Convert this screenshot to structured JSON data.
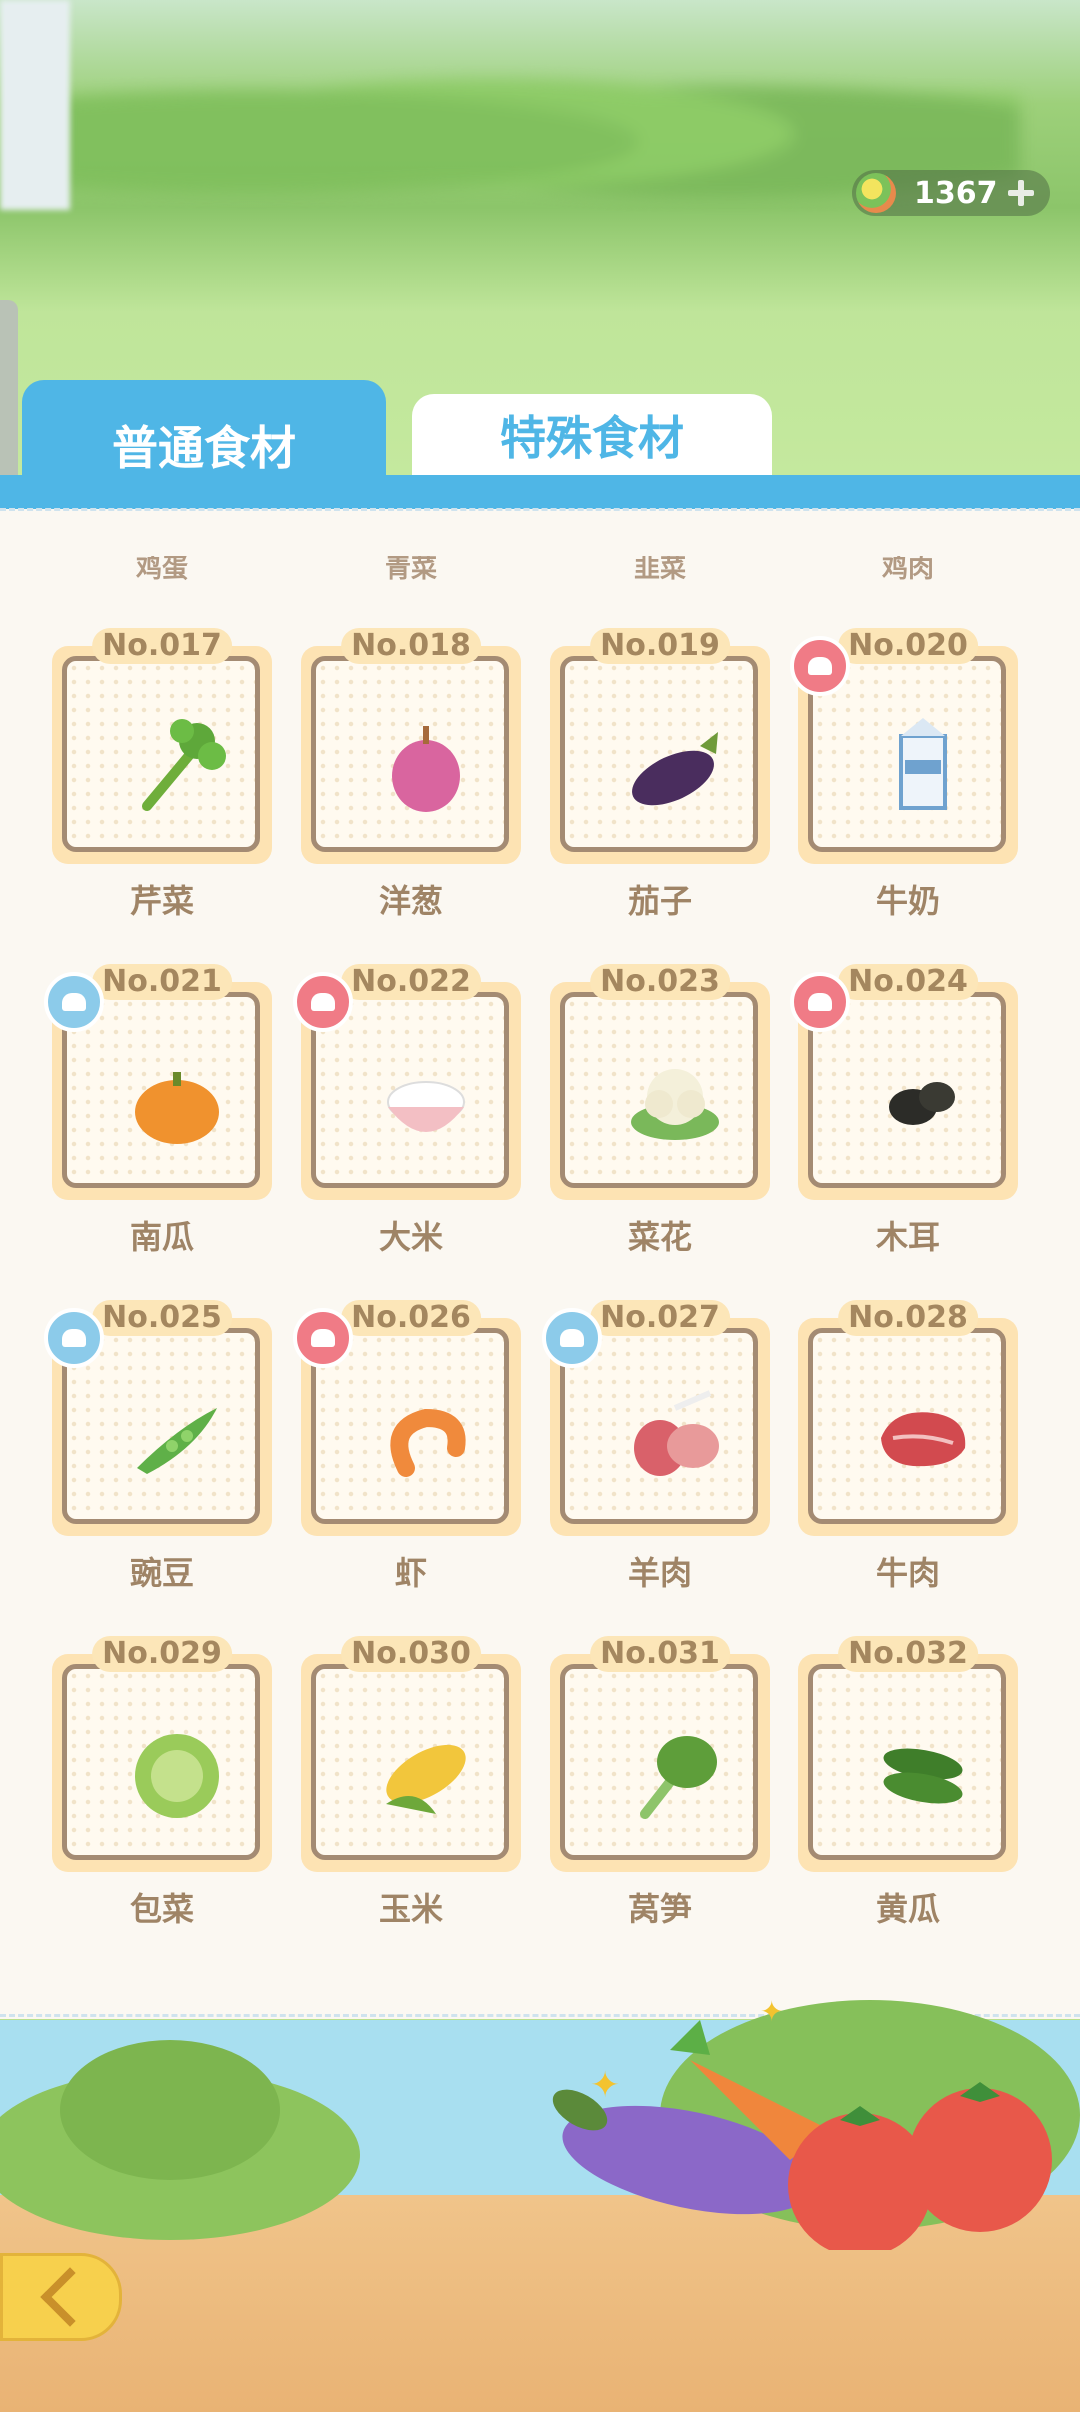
{
  "currency": {
    "icon": "rainbow-coin-icon",
    "amount": "1367",
    "add_icon": "plus-icon"
  },
  "tabs": [
    {
      "label": "普通食材",
      "active": true
    },
    {
      "label": "特殊食材",
      "active": false
    }
  ],
  "previous_row_names": [
    "鸡蛋",
    "青菜",
    "韭菜",
    "鸡肉"
  ],
  "ingredients": [
    {
      "no": "No.017",
      "name": "芹菜",
      "badge": "none",
      "icon": "celery-icon"
    },
    {
      "no": "No.018",
      "name": "洋葱",
      "badge": "none",
      "icon": "onion-icon"
    },
    {
      "no": "No.019",
      "name": "茄子",
      "badge": "none",
      "icon": "eggplant-icon"
    },
    {
      "no": "No.020",
      "name": "牛奶",
      "badge": "red",
      "icon": "milk-carton-icon"
    },
    {
      "no": "No.021",
      "name": "南瓜",
      "badge": "blue",
      "icon": "pumpkin-icon"
    },
    {
      "no": "No.022",
      "name": "大米",
      "badge": "red",
      "icon": "rice-bowl-icon"
    },
    {
      "no": "No.023",
      "name": "菜花",
      "badge": "none",
      "icon": "cauliflower-icon"
    },
    {
      "no": "No.024",
      "name": "木耳",
      "badge": "red",
      "icon": "wood-ear-fungus-icon"
    },
    {
      "no": "No.025",
      "name": "豌豆",
      "badge": "blue",
      "icon": "pea-pod-icon"
    },
    {
      "no": "No.026",
      "name": "虾",
      "badge": "red",
      "icon": "shrimp-icon"
    },
    {
      "no": "No.027",
      "name": "羊肉",
      "badge": "blue",
      "icon": "lamb-meat-icon"
    },
    {
      "no": "No.028",
      "name": "牛肉",
      "badge": "none",
      "icon": "beef-icon"
    },
    {
      "no": "No.029",
      "name": "包菜",
      "badge": "none",
      "icon": "cabbage-icon"
    },
    {
      "no": "No.030",
      "name": "玉米",
      "badge": "none",
      "icon": "corn-icon"
    },
    {
      "no": "No.031",
      "name": "莴笋",
      "badge": "none",
      "icon": "lettuce-icon"
    },
    {
      "no": "No.032",
      "name": "黄瓜",
      "badge": "none",
      "icon": "cucumber-icon"
    }
  ],
  "colors": {
    "tab_blue": "#4fb6e6",
    "card_frame": "#fde3b3",
    "badge_red": "#f07b86",
    "badge_blue": "#8ccbea"
  },
  "back_button": {
    "icon": "back-arrow-icon"
  }
}
